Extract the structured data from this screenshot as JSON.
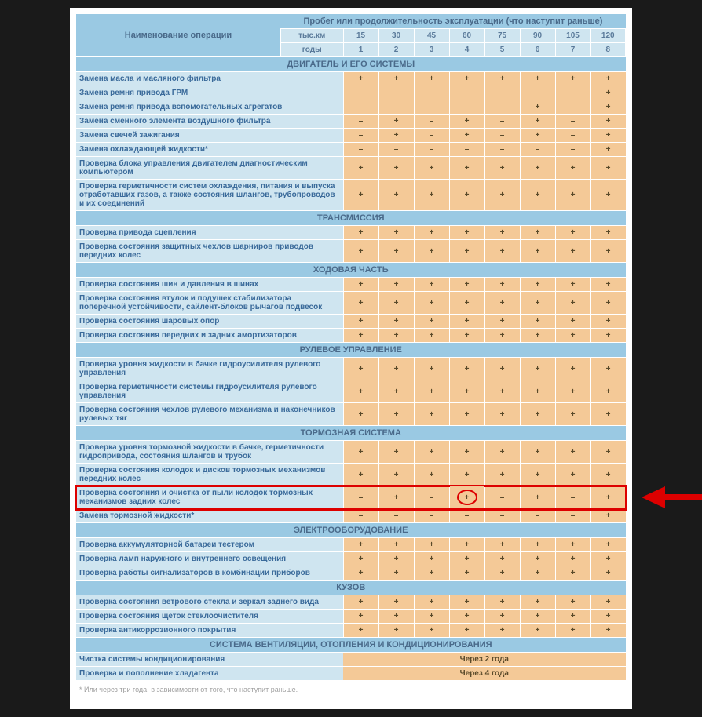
{
  "header": {
    "operation_col": "Наименование операции",
    "mileage_header": "Пробег или продолжительность эксплуатации (что наступит раньше)",
    "row1_label": "тыс.км",
    "row1_vals": [
      "15",
      "30",
      "45",
      "60",
      "75",
      "90",
      "105",
      "120"
    ],
    "row2_label": "годы",
    "row2_vals": [
      "1",
      "2",
      "3",
      "4",
      "5",
      "6",
      "7",
      "8"
    ]
  },
  "sections": [
    {
      "title": "ДВИГАТЕЛЬ И ЕГО СИСТЕМЫ",
      "rows": [
        {
          "name": "Замена масла и масляного фильтра",
          "v": [
            "+",
            "+",
            "+",
            "+",
            "+",
            "+",
            "+",
            "+"
          ]
        },
        {
          "name": "Замена ремня привода ГРМ",
          "v": [
            "–",
            "–",
            "–",
            "–",
            "–",
            "–",
            "–",
            "+"
          ]
        },
        {
          "name": "Замена ремня привода вспомогательных агрегатов",
          "v": [
            "–",
            "–",
            "–",
            "–",
            "–",
            "+",
            "–",
            "+"
          ]
        },
        {
          "name": "Замена сменного элемента воздушного фильтра",
          "v": [
            "–",
            "+",
            "–",
            "+",
            "–",
            "+",
            "–",
            "+"
          ]
        },
        {
          "name": "Замена свечей зажигания",
          "v": [
            "–",
            "+",
            "–",
            "+",
            "–",
            "+",
            "–",
            "+"
          ]
        },
        {
          "name": "Замена охлаждающей жидкости*",
          "v": [
            "–",
            "–",
            "–",
            "–",
            "–",
            "–",
            "–",
            "+"
          ]
        },
        {
          "name": "Проверка блока управления двигателем диагностическим компьютером",
          "v": [
            "+",
            "+",
            "+",
            "+",
            "+",
            "+",
            "+",
            "+"
          ]
        },
        {
          "name": "Проверка герметичности систем охлаждения, питания и выпуска отработавших газов, а также состояния шлангов, трубопроводов и их соединений",
          "v": [
            "+",
            "+",
            "+",
            "+",
            "+",
            "+",
            "+",
            "+"
          ]
        }
      ]
    },
    {
      "title": "ТРАНСМИССИЯ",
      "rows": [
        {
          "name": "Проверка привода сцепления",
          "v": [
            "+",
            "+",
            "+",
            "+",
            "+",
            "+",
            "+",
            "+"
          ]
        },
        {
          "name": "Проверка состояния защитных чехлов шарниров приводов передних колес",
          "v": [
            "+",
            "+",
            "+",
            "+",
            "+",
            "+",
            "+",
            "+"
          ]
        }
      ]
    },
    {
      "title": "ХОДОВАЯ ЧАСТЬ",
      "rows": [
        {
          "name": "Проверка состояния шин и давления в шинах",
          "v": [
            "+",
            "+",
            "+",
            "+",
            "+",
            "+",
            "+",
            "+"
          ]
        },
        {
          "name": "Проверка состояния втулок и подушек стабилизатора поперечной устойчивости, сайлент-блоков рычагов подвесок",
          "v": [
            "+",
            "+",
            "+",
            "+",
            "+",
            "+",
            "+",
            "+"
          ]
        },
        {
          "name": "Проверка состояния шаровых опор",
          "v": [
            "+",
            "+",
            "+",
            "+",
            "+",
            "+",
            "+",
            "+"
          ]
        },
        {
          "name": "Проверка состояния передних и задних амортизаторов",
          "v": [
            "+",
            "+",
            "+",
            "+",
            "+",
            "+",
            "+",
            "+"
          ]
        }
      ]
    },
    {
      "title": "РУЛЕВОЕ УПРАВЛЕНИЕ",
      "rows": [
        {
          "name": "Проверка уровня жидкости в бачке гидроусилителя рулевого управления",
          "v": [
            "+",
            "+",
            "+",
            "+",
            "+",
            "+",
            "+",
            "+"
          ]
        },
        {
          "name": "Проверка герметичности системы гидроусилителя рулевого управления",
          "v": [
            "+",
            "+",
            "+",
            "+",
            "+",
            "+",
            "+",
            "+"
          ]
        },
        {
          "name": "Проверка состояния чехлов рулевого механизма и наконечников рулевых тяг",
          "v": [
            "+",
            "+",
            "+",
            "+",
            "+",
            "+",
            "+",
            "+"
          ]
        }
      ]
    },
    {
      "title": "ТОРМОЗНАЯ СИСТЕМА",
      "rows": [
        {
          "name": "Проверка уровня тормозной жидкости в бачке, герметичности гидропривода, состояния шлангов и трубок",
          "v": [
            "+",
            "+",
            "+",
            "+",
            "+",
            "+",
            "+",
            "+"
          ]
        },
        {
          "name": "Проверка состояния колодок и дисков тормозных механизмов передних колес",
          "v": [
            "+",
            "+",
            "+",
            "+",
            "+",
            "+",
            "+",
            "+"
          ]
        },
        {
          "name": "Проверка состояния и очистка от пыли колодок тормозных механизмов задних колес",
          "v": [
            "–",
            "+",
            "–",
            "+",
            "–",
            "+",
            "–",
            "+"
          ],
          "highlight": true,
          "circleIndex": 3
        },
        {
          "name": "Замена тормозной жидкости*",
          "v": [
            "–",
            "–",
            "–",
            "–",
            "–",
            "–",
            "–",
            "+"
          ]
        }
      ]
    },
    {
      "title": "ЭЛЕКТРООБОРУДОВАНИЕ",
      "rows": [
        {
          "name": "Проверка аккумуляторной батареи тестером",
          "v": [
            "+",
            "+",
            "+",
            "+",
            "+",
            "+",
            "+",
            "+"
          ]
        },
        {
          "name": "Проверка ламп наружного и внутреннего освещения",
          "v": [
            "+",
            "+",
            "+",
            "+",
            "+",
            "+",
            "+",
            "+"
          ]
        },
        {
          "name": "Проверка работы сигнализаторов в комбинации приборов",
          "v": [
            "+",
            "+",
            "+",
            "+",
            "+",
            "+",
            "+",
            "+"
          ]
        }
      ]
    },
    {
      "title": "КУЗОВ",
      "rows": [
        {
          "name": "Проверка состояния ветрового стекла и зеркал заднего вида",
          "v": [
            "+",
            "+",
            "+",
            "+",
            "+",
            "+",
            "+",
            "+"
          ]
        },
        {
          "name": "Проверка состояния щеток стеклоочистителя",
          "v": [
            "+",
            "+",
            "+",
            "+",
            "+",
            "+",
            "+",
            "+"
          ]
        },
        {
          "name": "Проверка антикоррозионного покрытия",
          "v": [
            "+",
            "+",
            "+",
            "+",
            "+",
            "+",
            "+",
            "+"
          ]
        }
      ]
    },
    {
      "title": "СИСТЕМА ВЕНТИЛЯЦИИ, ОТОПЛЕНИЯ И КОНДИЦИОНИРОВАНИЯ",
      "rows": [
        {
          "name": "Чистка системы кондиционирования",
          "merged": "Через 2 года"
        },
        {
          "name": "Проверка и пополнение хладагента",
          "merged": "Через 4 года"
        }
      ]
    }
  ],
  "footnote": "*   Или через три года, в зависимости от того, что наступит раньше."
}
